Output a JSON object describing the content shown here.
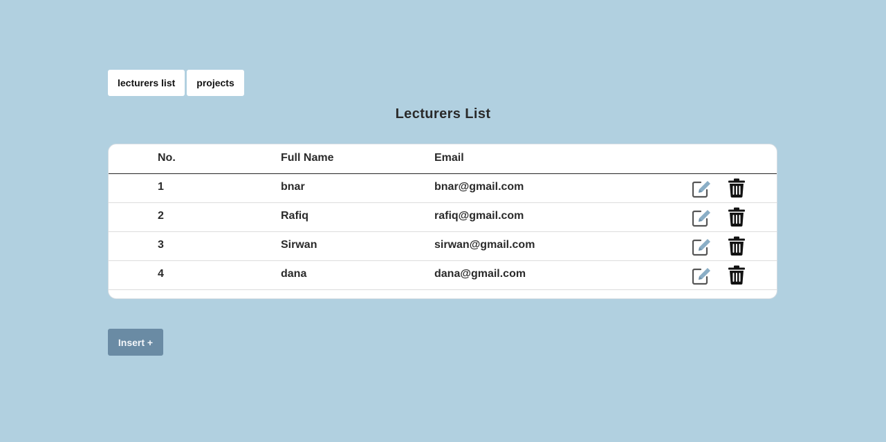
{
  "nav": {
    "tabs": [
      {
        "label": "lecturers list"
      },
      {
        "label": "projects"
      }
    ]
  },
  "page": {
    "title": "Lecturers List"
  },
  "table": {
    "headers": {
      "no": "No.",
      "full_name": "Full Name",
      "email": "Email"
    },
    "rows": [
      {
        "no": "1",
        "full_name": "bnar",
        "email": "bnar@gmail.com"
      },
      {
        "no": "2",
        "full_name": "Rafiq",
        "email": "rafiq@gmail.com"
      },
      {
        "no": "3",
        "full_name": "Sirwan",
        "email": "sirwan@gmail.com"
      },
      {
        "no": "4",
        "full_name": "dana",
        "email": "dana@gmail.com"
      }
    ],
    "row_actions": {
      "edit_icon": "edit-icon",
      "delete_icon": "trash-icon"
    }
  },
  "actions": {
    "insert_label": "Insert +"
  },
  "colors": {
    "background": "#b1d0e0",
    "primary_button": "#6a8ba4",
    "edit_pencil": "#8aaec6"
  }
}
